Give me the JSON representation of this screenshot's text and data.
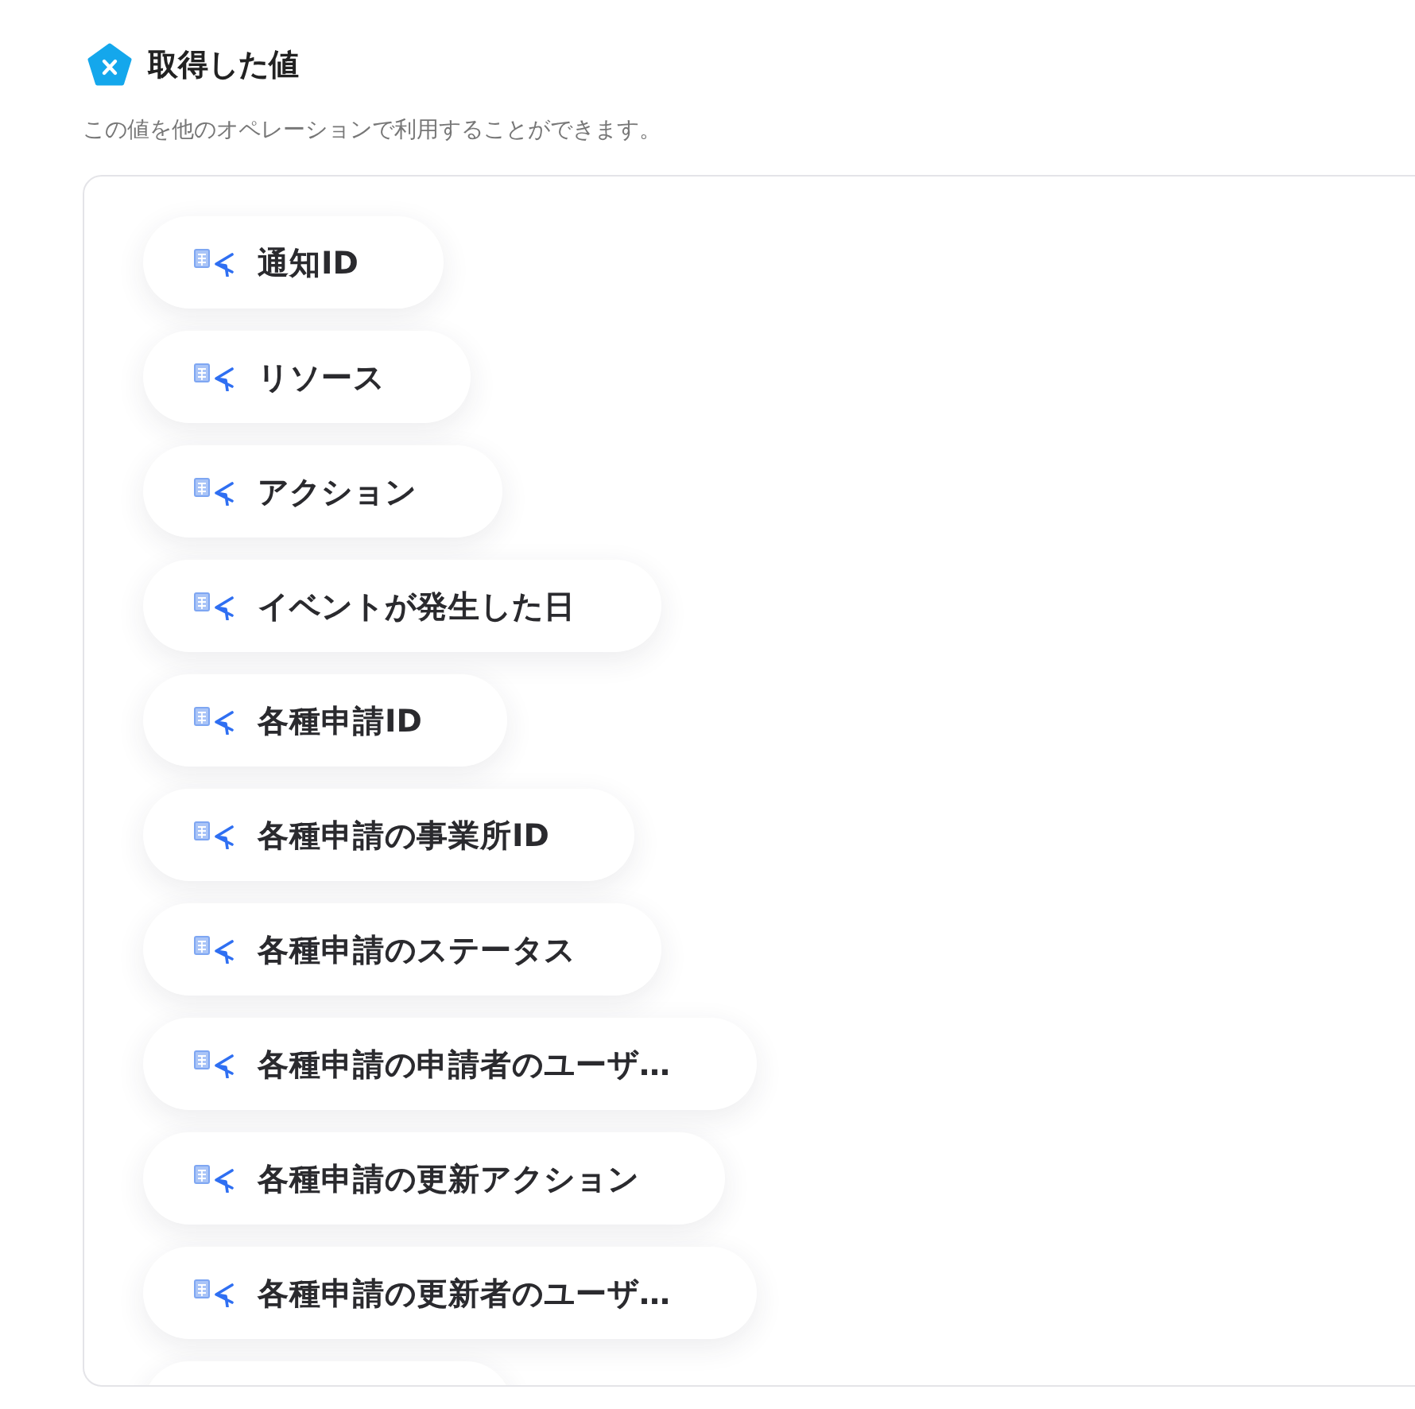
{
  "header": {
    "title": "取得した値",
    "description": "この値を他のオペレーションで利用することができます。"
  },
  "values": [
    "通知ID",
    "リソース",
    "アクション",
    "イベントが発生した日",
    "各種申請ID",
    "各種申請の事業所ID",
    "各種申請のステータス",
    "各種申請の申請者のユーザ…",
    "各種申請の更新アクション",
    "各種申請の更新者のユーザ…"
  ],
  "clipped_item_below": true
}
